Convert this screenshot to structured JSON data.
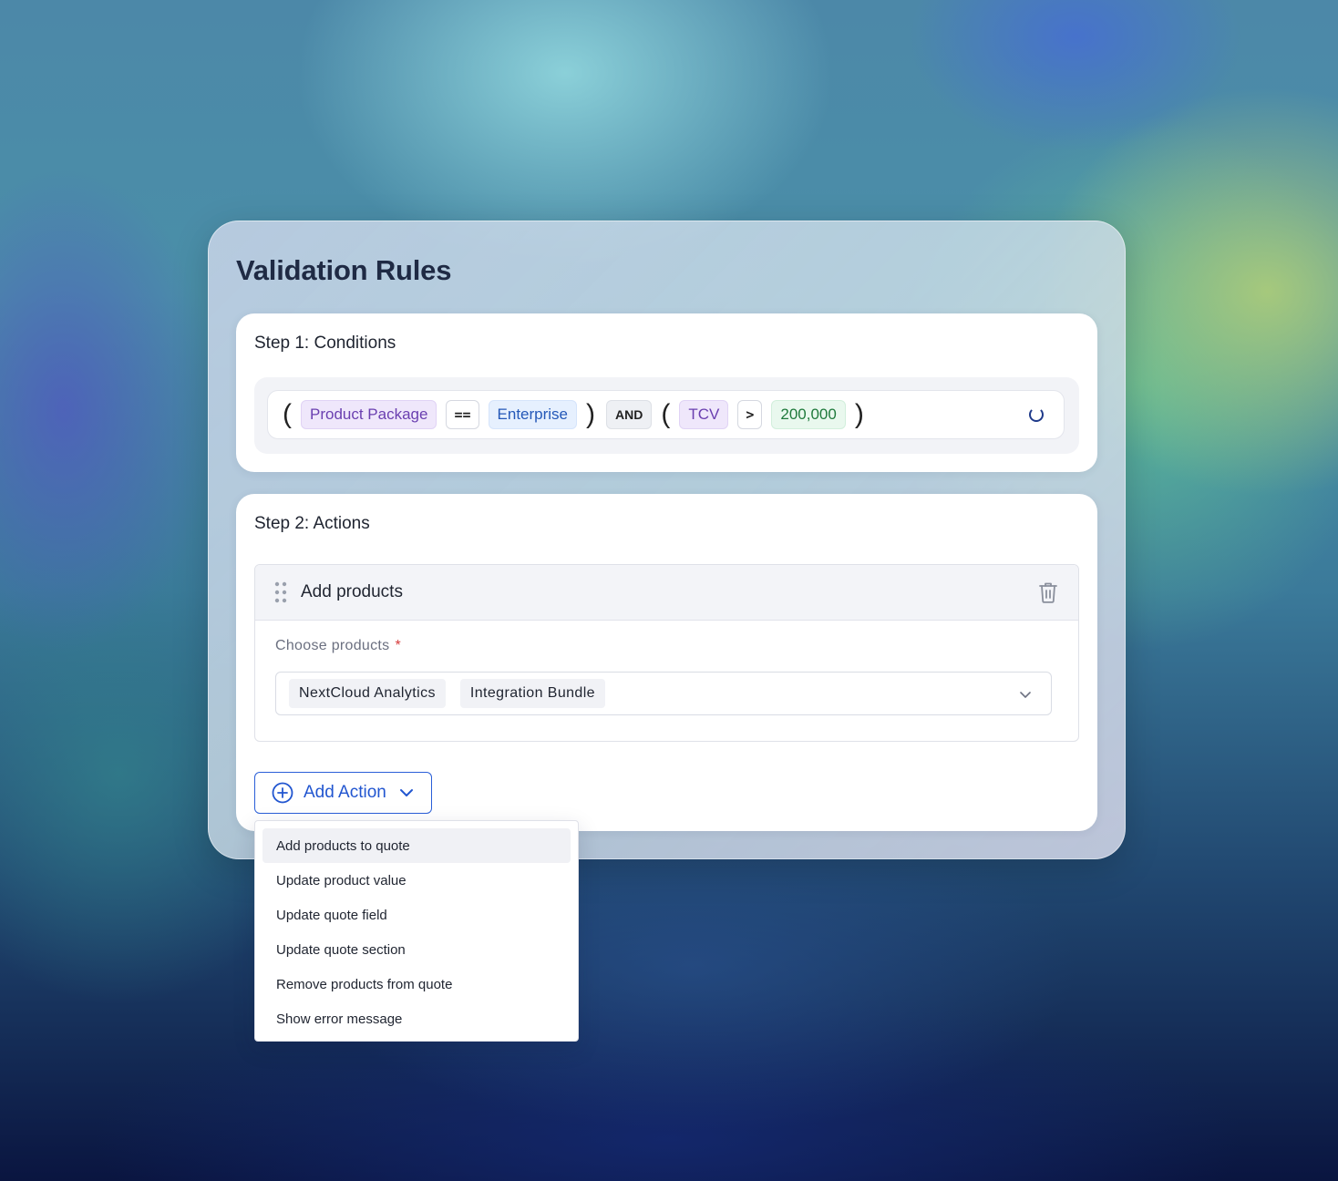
{
  "panel": {
    "title": "Validation Rules"
  },
  "conditions": {
    "title": "Step 1: Conditions",
    "open_paren": "(",
    "close_paren": ")",
    "tokens": {
      "field1": "Product Package",
      "op1": "==",
      "value1": "Enterprise",
      "logic": "AND",
      "field2": "TCV",
      "op2": ">",
      "value2": "200,000"
    }
  },
  "actions": {
    "title": "Step 2: Actions",
    "action": {
      "name": "Add products",
      "field_label": "Choose products",
      "required_mark": "*",
      "selected": [
        "NextCloud Analytics",
        "Integration Bundle"
      ]
    },
    "add_button_label": "Add Action"
  },
  "menu": {
    "items": [
      "Add products to quote",
      "Update product value",
      "Update quote field",
      "Update quote section",
      "Remove products from quote",
      "Show error message"
    ],
    "highlighted_index": 0
  },
  "colors": {
    "accent": "#2256d0",
    "title": "#1f2a44",
    "token_purple": "#6a3fb0",
    "token_blue": "#2458b8",
    "token_green": "#1f7a3c",
    "required": "#d63b3b"
  }
}
